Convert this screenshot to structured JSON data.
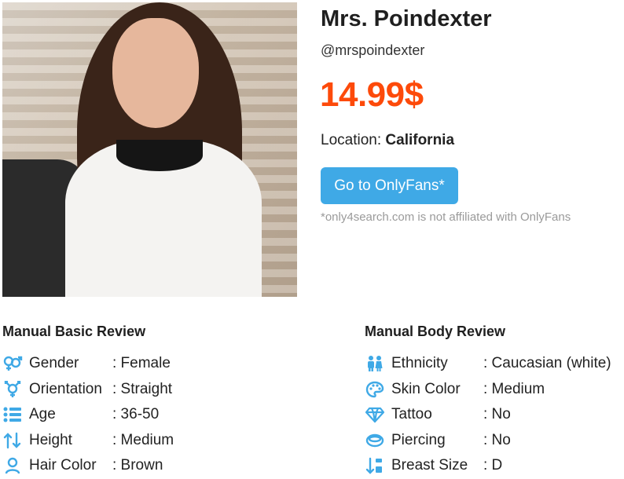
{
  "profile": {
    "name": "Mrs. Poindexter",
    "handle": "@mrspoindexter",
    "price": "14.99$",
    "location_label": "Location:",
    "location_value": "California",
    "cta_label": "Go to OnlyFans*",
    "disclaimer": "*only4search.com is not affiliated with OnlyFans"
  },
  "basic_review": {
    "title": "Manual Basic Review",
    "items": [
      {
        "icon": "gender-icon",
        "label": "Gender",
        "value": ": Female"
      },
      {
        "icon": "orientation-icon",
        "label": "Orientation",
        "value": ": Straight"
      },
      {
        "icon": "age-list-icon",
        "label": "Age",
        "value": ": 36-50"
      },
      {
        "icon": "height-arrows-icon",
        "label": "Height",
        "value": ": Medium"
      },
      {
        "icon": "hair-color-icon",
        "label": "Hair Color",
        "value": ": Brown"
      }
    ]
  },
  "body_review": {
    "title": "Manual Body Review",
    "items": [
      {
        "icon": "ethnicity-people-icon",
        "label": "Ethnicity",
        "value": ": Caucasian (white)"
      },
      {
        "icon": "palette-icon",
        "label": "Skin Color",
        "value": ": Medium"
      },
      {
        "icon": "diamond-icon",
        "label": "Tattoo",
        "value": ": No"
      },
      {
        "icon": "ring-icon",
        "label": "Piercing",
        "value": ": No"
      },
      {
        "icon": "sort-down-icon",
        "label": "Breast Size",
        "value": ": D"
      }
    ]
  },
  "colors": {
    "accent": "#3fa9e6",
    "price": "#fd4a0a",
    "icon": "#3fa9e6"
  }
}
